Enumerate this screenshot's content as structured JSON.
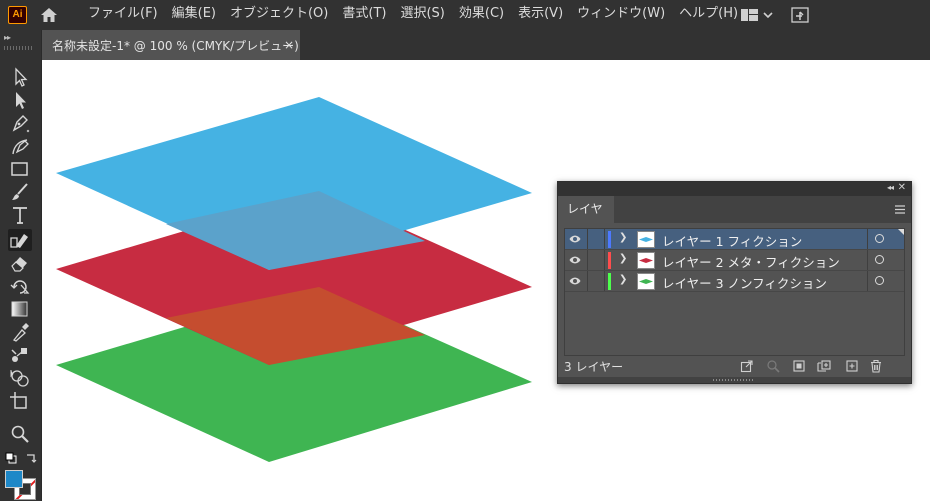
{
  "app": {
    "logo_text": "Ai",
    "menu": [
      "ファイル(F)",
      "編集(E)",
      "オブジェクト(O)",
      "書式(T)",
      "選択(S)",
      "効果(C)",
      "表示(V)",
      "ウィンドウ(W)",
      "ヘルプ(H)"
    ]
  },
  "document": {
    "tab_title": "名称未設定-1* @ 100 % (CMYK/プレビュー)",
    "close_glyph": "×"
  },
  "tools": [
    "selection-tool",
    "direct-selection-tool",
    "pen-tool",
    "curvature-tool",
    "rectangle-tool",
    "paintbrush-tool",
    "type-tool",
    "shaper-tool",
    "eraser-tool",
    "rotate-tool",
    "gradient-tool",
    "eyedropper-tool",
    "blend-tool",
    "shape-builder-tool",
    "artboard-tool",
    "zoom-tool"
  ],
  "colors": {
    "fill": "#1e88c8",
    "stroke": "none"
  },
  "artwork": {
    "shapes": [
      {
        "name": "green-diamond",
        "color": "#3fb552"
      },
      {
        "name": "red-diamond",
        "color": "#c72c41"
      },
      {
        "name": "blue-diamond",
        "color": "#45b2e3"
      }
    ]
  },
  "layers_panel": {
    "tab_label": "レイヤー",
    "collapse_glyph": "◂◂",
    "close_glyph": "✕",
    "layers": [
      {
        "name": "レイヤー 1 フィクション",
        "color": "#4d79ff",
        "thumb_color": "#45b2e3",
        "selected": true
      },
      {
        "name": "レイヤー 2 メタ・フィクション",
        "color": "#ff4d4d",
        "thumb_color": "#c72c41",
        "selected": false
      },
      {
        "name": "レイヤー 3 ノンフィクション",
        "color": "#4dff4d",
        "thumb_color": "#3fb552",
        "selected": false
      }
    ],
    "count_label": "3 レイヤー",
    "footer_buttons": [
      "export-for-screens-icon",
      "locate-object-icon",
      "make-clipping-mask-icon",
      "new-sublayer-icon",
      "new-layer-icon",
      "delete-icon"
    ]
  }
}
